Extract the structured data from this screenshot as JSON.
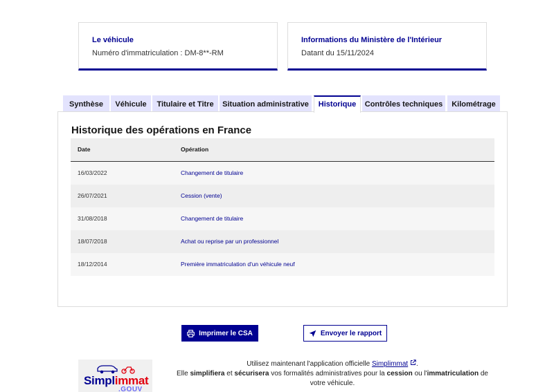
{
  "vehicle_card": {
    "title": "Le véhicule",
    "value": "Numéro d'immatriculation : DM-8**-RM"
  },
  "ministry_card": {
    "title": "Informations du Ministère de l'Intérieur",
    "value": "Datant du 15/11/2024"
  },
  "tabs": [
    {
      "label": "Synthèse",
      "active": false
    },
    {
      "label": "Véhicule",
      "active": false
    },
    {
      "label": "Titulaire et Titre",
      "active": false
    },
    {
      "label": "Situation administrative",
      "active": false
    },
    {
      "label": "Historique",
      "active": true
    },
    {
      "label": "Contrôles techniques",
      "active": false
    },
    {
      "label": "Kilométrage",
      "active": false
    }
  ],
  "history": {
    "title": "Historique des opérations en France",
    "columns": {
      "date": "Date",
      "operation": "Opération"
    },
    "rows": [
      {
        "date": "16/03/2022",
        "operation": "Changement de titulaire"
      },
      {
        "date": "26/07/2021",
        "operation": "Cession (vente)"
      },
      {
        "date": "31/08/2018",
        "operation": "Changement de titulaire"
      },
      {
        "date": "18/07/2018",
        "operation": "Achat ou reprise par un professionnel"
      },
      {
        "date": "18/12/2014",
        "operation": "Première immatriculation d'un véhicule neuf"
      }
    ]
  },
  "actions": {
    "print_label": "Imprimer le CSA",
    "print_icon": "printer-icon",
    "send_label": "Envoyer le rapport",
    "send_icon": "send-icon"
  },
  "promo": {
    "line1_prefix": "Utilisez maintenant l'application officielle",
    "link_label": "Simplimmat",
    "link_icon": "external-link-icon",
    "line1_suffix": ".",
    "line2_part1": "Elle",
    "bold1": "simplifiera",
    "line2_part2": "et",
    "bold2": "sécurisera",
    "line2_part3": "vos formalités administratives pour la",
    "bold3": "cession",
    "line2_part4": "ou l'",
    "bold4": "immatriculation",
    "line2_part5": "de votre véhicule."
  },
  "logo": {
    "text_blue": "Simpl",
    "text_red": "immat",
    "suffix": ".GOUV"
  },
  "colors": {
    "brand_blue": "#000091",
    "tab_bg": "#e3e3fd",
    "accent_red": "#e1000f"
  }
}
